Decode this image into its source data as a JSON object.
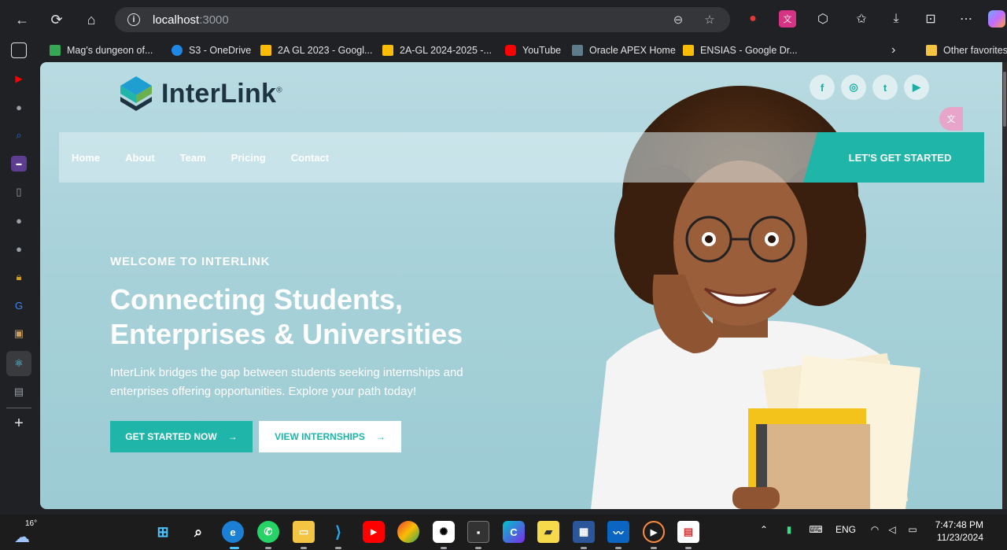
{
  "browser": {
    "url_host": "localhost",
    "url_port": ":3000",
    "bookmarks": [
      {
        "label": "Mag's dungeon of...",
        "color": "#34a853"
      },
      {
        "label": "S3 - OneDrive",
        "color": "#1e88e5"
      },
      {
        "label": "2A GL 2023 - Googl...",
        "color": "#fbbc04"
      },
      {
        "label": "2A-GL 2024-2025 -...",
        "color": "#fbbc04"
      },
      {
        "label": "YouTube",
        "color": "#ff0000"
      },
      {
        "label": "Oracle APEX Home",
        "color": "#5f7c8a"
      },
      {
        "label": "ENSIAS - Google Dr...",
        "color": "#fbbc04"
      }
    ],
    "other_favorites": "Other favorites"
  },
  "site": {
    "brand": "InterLink",
    "brand_mark": "®",
    "nav": [
      "Home",
      "About",
      "Team",
      "Pricing",
      "Contact"
    ],
    "cta_top": "LET'S GET STARTED",
    "socials": [
      "f",
      "◎",
      "t",
      "▶"
    ],
    "hero": {
      "kicker": "WELCOME TO INTERLINK",
      "title_line1": "Connecting Students,",
      "title_line2": "Enterprises & Universities",
      "text_line1": "InterLink bridges the gap between students seeking internships and",
      "text_line2": "enterprises offering opportunities. Explore your path today!",
      "btn_primary": "GET STARTED NOW",
      "btn_secondary": "VIEW INTERNSHIPS",
      "arrow": "→"
    },
    "accent": "#1fb5a8"
  },
  "taskbar": {
    "temperature": "16°",
    "lang": "ENG",
    "time": "7:47:48 PM",
    "date": "11/23/2024"
  }
}
